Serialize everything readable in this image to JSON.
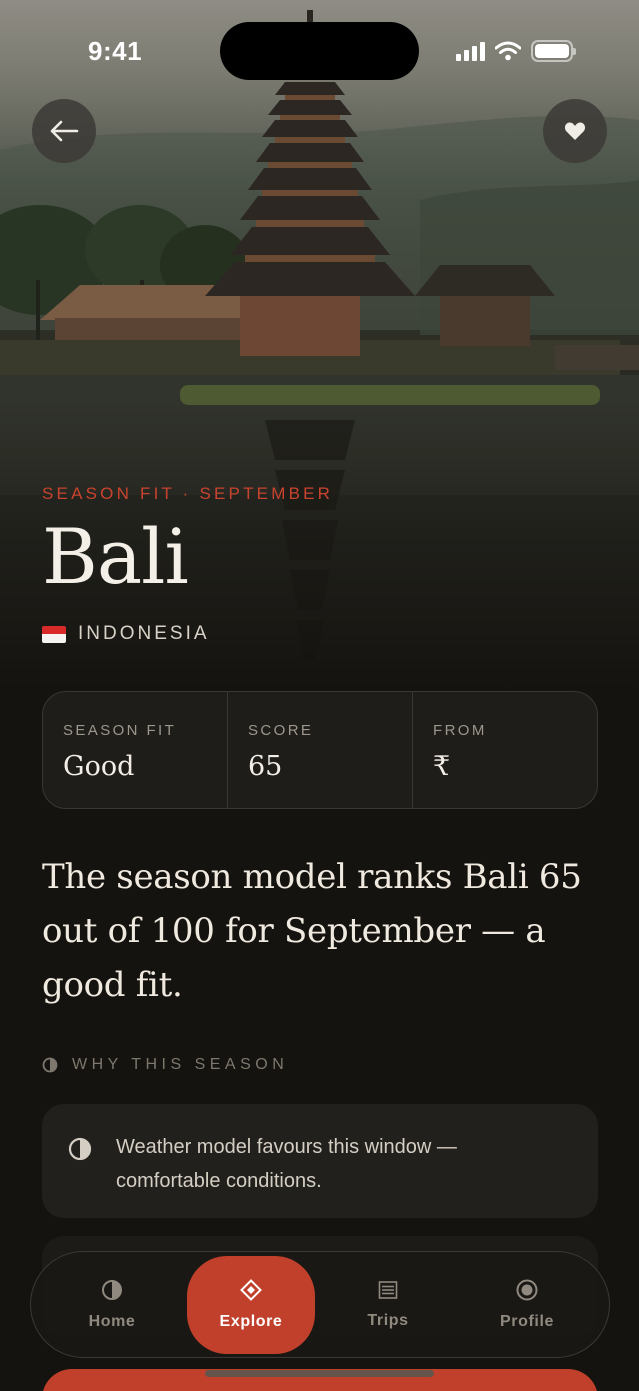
{
  "status_bar": {
    "time": "9:41"
  },
  "hero": {
    "eyebrow": "SEASON FIT · SEPTEMBER",
    "title": "Bali",
    "country": "INDONESIA",
    "flag_icon": "indonesia-flag-icon"
  },
  "stats": [
    {
      "label": "SEASON FIT",
      "value": "Good"
    },
    {
      "label": "SCORE",
      "value": "65"
    },
    {
      "label": "FROM",
      "value": "₹"
    }
  ],
  "summary": "The season model ranks Bali 65 out of 100 for September — a good fit.",
  "section": {
    "title": "WHY THIS SEASON",
    "icon": "half-circle-icon"
  },
  "reasons": [
    {
      "icon": "half-circle-icon",
      "text": "Weather model favours this window — comfortable conditions."
    }
  ],
  "tabs": [
    {
      "label": "Home",
      "icon": "half-circle-icon",
      "active": false
    },
    {
      "label": "Explore",
      "icon": "diamond-icon",
      "active": true
    },
    {
      "label": "Trips",
      "icon": "list-icon",
      "active": false
    },
    {
      "label": "Profile",
      "icon": "profile-circle-icon",
      "active": false
    }
  ],
  "colors": {
    "accent": "#c1402b",
    "eyebrow": "#c9432f",
    "background": "#15130f",
    "card": "#22201c"
  }
}
